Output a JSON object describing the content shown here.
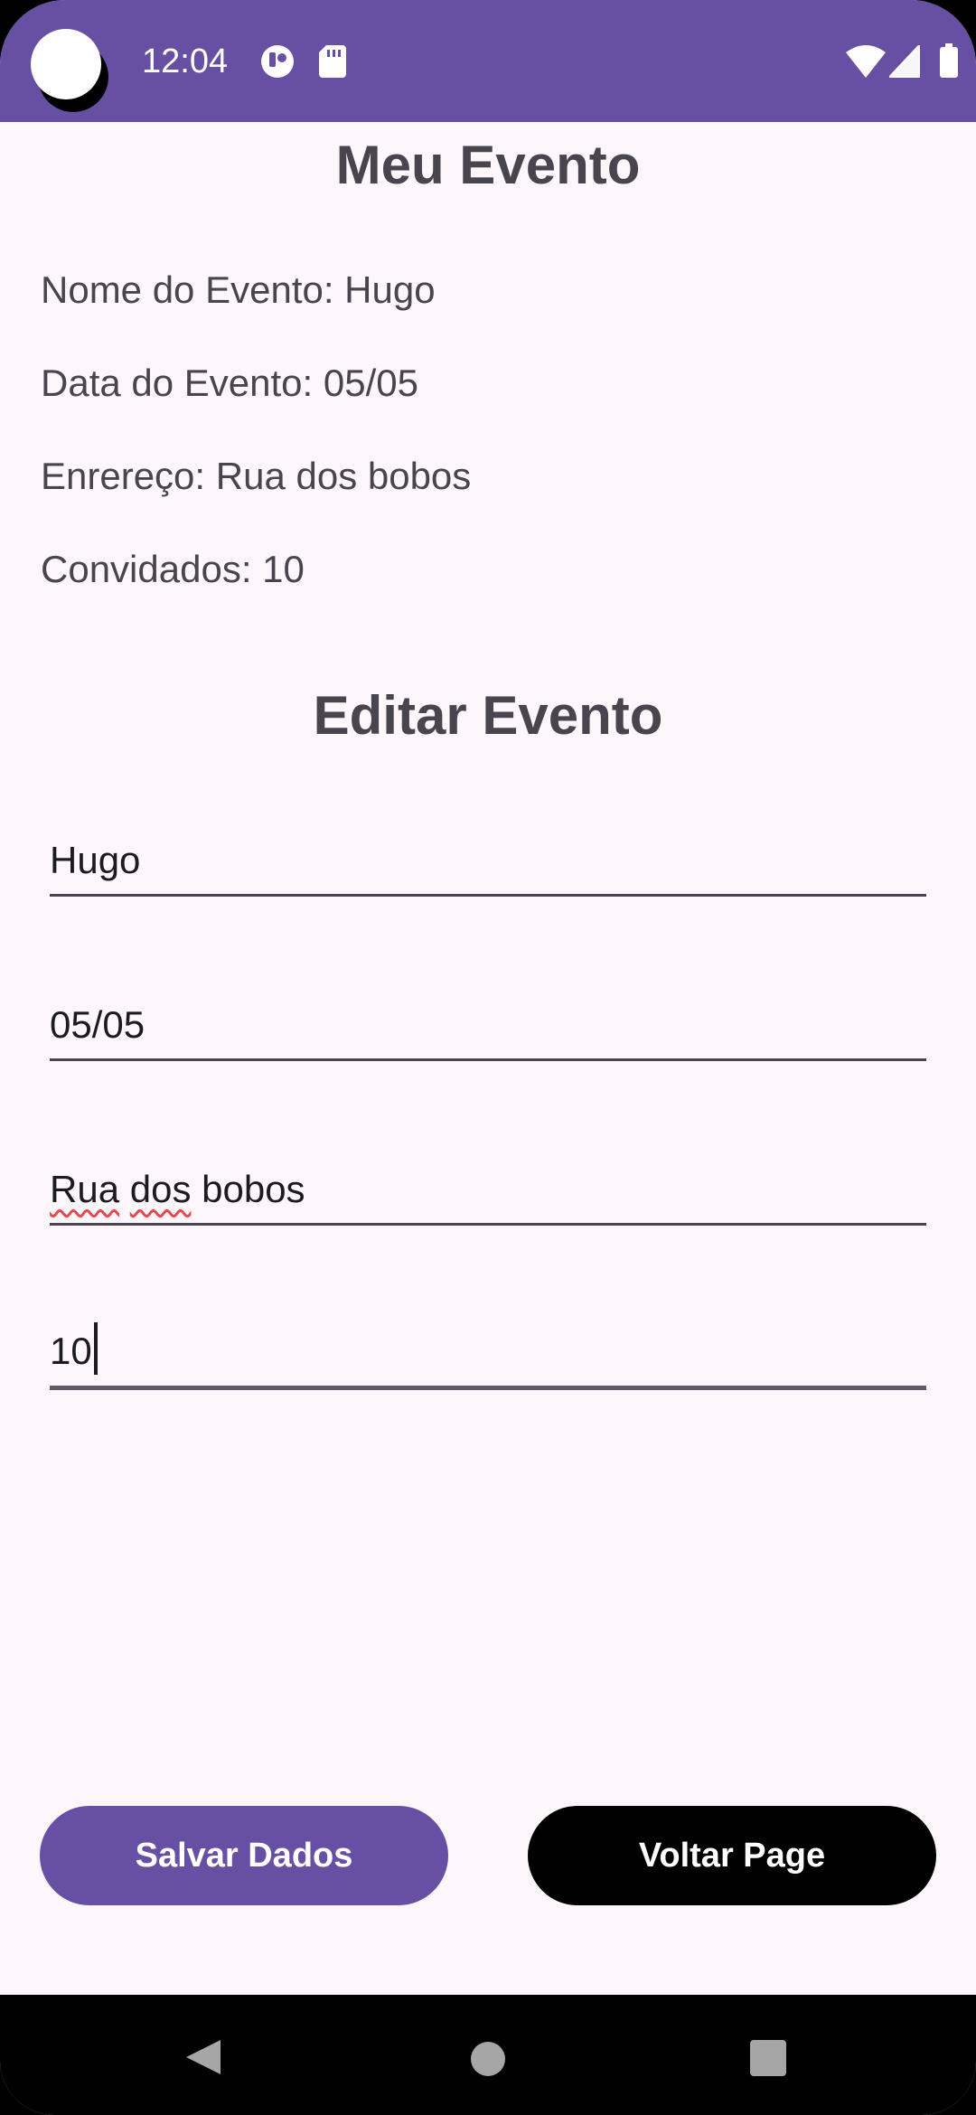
{
  "status_bar": {
    "time": "12:04",
    "icons": [
      "camera-dot",
      "notification-icon",
      "sd-card-icon",
      "wifi-icon",
      "signal-icon",
      "battery-icon"
    ]
  },
  "event": {
    "title": "Meu Evento",
    "name_line": "Nome do Evento: Hugo",
    "date_line": "Data do Evento: 05/05",
    "address_line": "Enrereço: Rua dos bobos",
    "guests_line": "Convidados: 10"
  },
  "edit": {
    "title": "Editar Evento",
    "name_value": "Hugo",
    "date_value": "05/05",
    "address_words": [
      "Rua",
      "dos",
      "bobos"
    ],
    "guests_value": "10"
  },
  "buttons": {
    "save_label": "Salvar Dados",
    "back_label": "Voltar Page"
  },
  "colors": {
    "primary": "#6750A4",
    "background": "#FDF7FC",
    "text": "#49454F",
    "spellcheck": "#E5484D"
  },
  "nav_bar": {
    "icons": [
      "back-icon",
      "home-icon",
      "recents-icon"
    ]
  }
}
